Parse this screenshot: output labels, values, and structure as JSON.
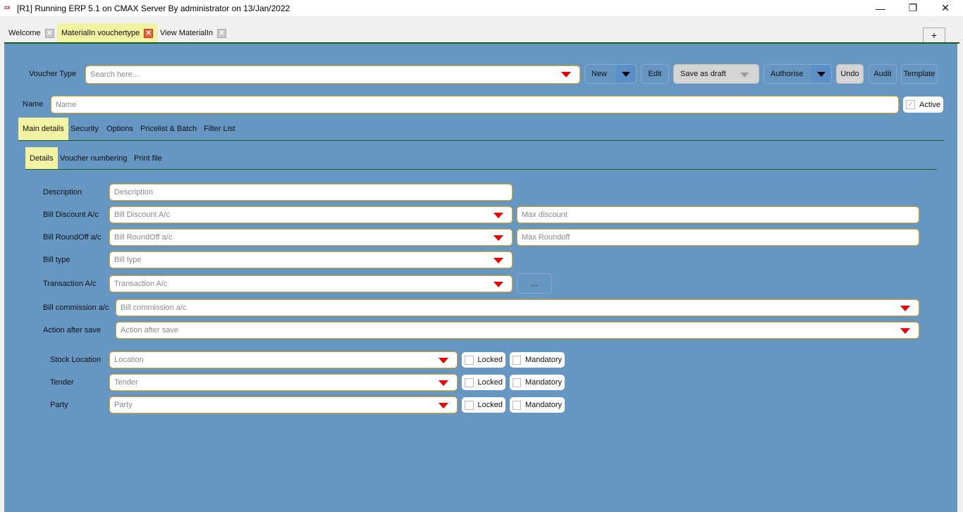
{
  "window": {
    "app_icon": "cx",
    "title": "[R1] Running ERP 5.1 on CMAX Server By administrator on 13/Jan/2022",
    "controls": {
      "minimize": "—",
      "maximize": "❐",
      "close": "✕"
    }
  },
  "doc_tabs": [
    {
      "label": "Welcome",
      "close": "✕",
      "active": false
    },
    {
      "label": "MaterialIn vouchertype",
      "close": "✕",
      "active": true
    },
    {
      "label": "View MaterialIn",
      "close": "✕",
      "active": false
    }
  ],
  "add_tab_label": "+",
  "toolbar": {
    "voucher_type_label": "Voucher Type",
    "voucher_type_placeholder": "Search here...",
    "new_label": "New",
    "edit_label": "Edit",
    "save_draft_label": "Save as draft",
    "authorise_label": "Authorise",
    "undo_label": "Undo",
    "audit_label": "Audit",
    "template_label": "Template"
  },
  "name_row": {
    "label": "Name",
    "placeholder": "Name",
    "active_label": "Active",
    "active_checked": true,
    "check_glyph": "✓"
  },
  "main_tabs": [
    {
      "label": "Main details",
      "active": true
    },
    {
      "label": "Security",
      "active": false
    },
    {
      "label": "Options",
      "active": false
    },
    {
      "label": "Pricelist & Batch",
      "active": false
    },
    {
      "label": "Filter List",
      "active": false
    }
  ],
  "sub_tabs": [
    {
      "label": "Details",
      "active": true
    },
    {
      "label": "Voucher numbering",
      "active": false
    },
    {
      "label": "Print file",
      "active": false
    }
  ],
  "form": {
    "description": {
      "label": "Description",
      "placeholder": "Description"
    },
    "bill_discount": {
      "label": "Bill Discount A/c",
      "placeholder": "Bill Discount A/c"
    },
    "max_discount": {
      "placeholder": "Max discount"
    },
    "bill_roundoff": {
      "label": "Bill RoundOff a/c",
      "placeholder": "Bill RoundOff a/c"
    },
    "max_roundoff": {
      "placeholder": "Max Roundoff"
    },
    "bill_type": {
      "label": "Bill type",
      "placeholder": "Bill type"
    },
    "transaction_ac": {
      "label": "Transaction A/c",
      "placeholder": "Transaction A/c",
      "more_label": "..."
    },
    "bill_commission": {
      "label": "Bill commission a/c",
      "placeholder": "Bill commission a/c"
    },
    "action_after_save": {
      "label": "Action after save",
      "placeholder": "Action after save"
    }
  },
  "defaults": [
    {
      "label": "Stock Location",
      "placeholder": "Location",
      "locked_label": "Locked",
      "locked": false,
      "mandatory_label": "Mandatory",
      "mandatory": false
    },
    {
      "label": "Tender",
      "placeholder": "Tender",
      "locked_label": "Locked",
      "locked": false,
      "mandatory_label": "Mandatory",
      "mandatory": false
    },
    {
      "label": "Party",
      "placeholder": "Party",
      "locked_label": "Locked",
      "locked": false,
      "mandatory_label": "Mandatory",
      "mandatory": false
    }
  ],
  "colors": {
    "panel_bg": "#6696c2",
    "active_tab": "#f2f2a3",
    "field_border": "#e8a317",
    "dropdown_arrow": "#e60000",
    "tab_underline": "#1a5c1a"
  }
}
